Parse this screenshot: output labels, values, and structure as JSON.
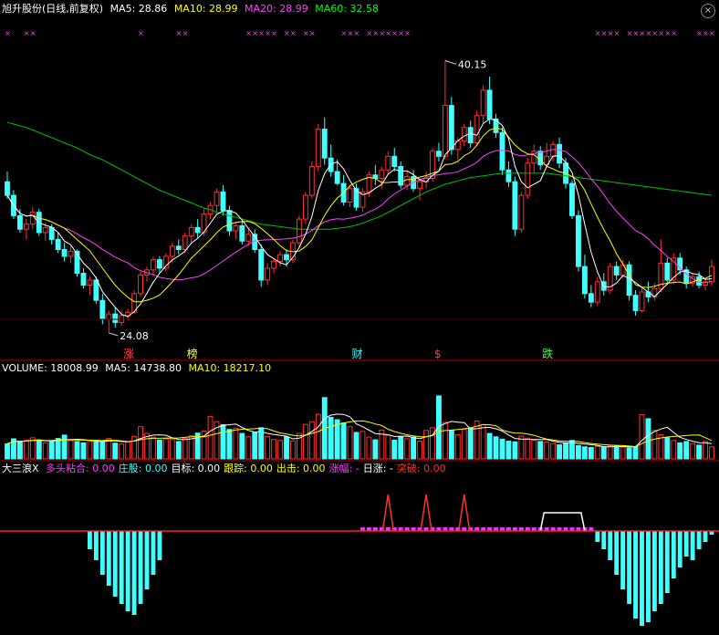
{
  "price_panel": {
    "stock_name": "旭升股份(日线,前复权)",
    "ma5": "MA5: 28.86",
    "ma10": "MA10: 28.99",
    "ma20": "MA20: 28.99",
    "ma60": "MA60: 32.58",
    "high_label": "40.15",
    "low_label": "24.08",
    "event_labels": [
      "涨",
      "榜",
      "财",
      "$",
      "跌"
    ]
  },
  "volume_panel": {
    "volume": "VOLUME: 18008.99",
    "ma5": "MA5: 14738.80",
    "ma10": "MA10: 18217.10"
  },
  "indicator_panel": {
    "name": "大三浪X",
    "items": [
      {
        "label": "多头粘合: 0.00",
        "color": "#ff40ff"
      },
      {
        "label": "庄股: 0.00",
        "color": "#40ffff"
      },
      {
        "label": "目标: 0.00",
        "color": "#ffffff"
      },
      {
        "label": "跟踪: 0.00",
        "color": "#ffff00"
      },
      {
        "label": "出击: 0.00",
        "color": "#ffff00"
      },
      {
        "label": "涨幅: -",
        "color": "#ff40ff"
      },
      {
        "label": "日涨: -",
        "color": "#ffffff"
      },
      {
        "label": "突破: 0.00",
        "color": "#ff3030"
      }
    ]
  },
  "colors": {
    "up": "#ff3030",
    "down": "#40ffff",
    "ma5": "#ffffff",
    "ma10": "#ffff00",
    "ma20": "#ff40ff",
    "ma60": "#00c000",
    "border": "#b00000"
  },
  "chart_data": [
    {
      "type": "candlestick",
      "title": "旭升股份(日线,前复权)",
      "ylim": [
        23,
        42
      ],
      "annotations": [
        {
          "text": "40.15",
          "kind": "high"
        },
        {
          "text": "24.08",
          "kind": "low"
        }
      ],
      "ohlc": [
        [
          33.0,
          33.6,
          32.0,
          32.2
        ],
        [
          32.2,
          32.5,
          30.8,
          31.0
        ],
        [
          31.0,
          31.4,
          30.0,
          30.2
        ],
        [
          30.2,
          30.8,
          29.6,
          30.5
        ],
        [
          30.5,
          31.5,
          30.2,
          31.2
        ],
        [
          31.2,
          31.4,
          29.8,
          30.0
        ],
        [
          30.0,
          30.6,
          29.5,
          30.3
        ],
        [
          30.3,
          30.5,
          29.3,
          29.6
        ],
        [
          29.6,
          30.0,
          28.8,
          29.0
        ],
        [
          29.0,
          29.4,
          28.3,
          28.6
        ],
        [
          28.6,
          29.2,
          28.2,
          28.9
        ],
        [
          28.9,
          29.0,
          27.4,
          27.6
        ],
        [
          27.6,
          27.9,
          26.7,
          26.9
        ],
        [
          26.9,
          27.4,
          26.3,
          27.2
        ],
        [
          27.2,
          27.4,
          25.8,
          26.0
        ],
        [
          26.0,
          26.4,
          24.6,
          24.9
        ],
        [
          24.9,
          25.4,
          24.08,
          25.2
        ],
        [
          25.2,
          25.6,
          24.4,
          24.7
        ],
        [
          24.7,
          25.4,
          24.5,
          25.1
        ],
        [
          25.1,
          25.5,
          24.8,
          25.3
        ],
        [
          25.3,
          26.6,
          25.2,
          26.4
        ],
        [
          26.4,
          27.7,
          26.2,
          27.5
        ],
        [
          27.5,
          28.0,
          27.1,
          27.8
        ],
        [
          27.8,
          28.6,
          27.4,
          28.4
        ],
        [
          28.4,
          28.6,
          27.6,
          27.9
        ],
        [
          27.9,
          28.8,
          27.7,
          28.6
        ],
        [
          28.6,
          29.4,
          28.2,
          29.2
        ],
        [
          29.2,
          29.6,
          28.7,
          29.0
        ],
        [
          29.0,
          30.0,
          28.8,
          29.8
        ],
        [
          29.8,
          30.5,
          29.4,
          30.3
        ],
        [
          30.3,
          30.8,
          29.7,
          30.0
        ],
        [
          30.0,
          31.4,
          29.8,
          31.1
        ],
        [
          31.1,
          31.8,
          30.8,
          31.6
        ],
        [
          31.6,
          32.6,
          31.2,
          32.4
        ],
        [
          32.4,
          32.8,
          31.0,
          31.3
        ],
        [
          31.3,
          31.6,
          29.8,
          30.1
        ],
        [
          30.1,
          30.6,
          29.6,
          30.4
        ],
        [
          30.4,
          30.7,
          29.3,
          29.5
        ],
        [
          29.5,
          30.2,
          29.2,
          29.9
        ],
        [
          29.9,
          30.2,
          28.8,
          29.0
        ],
        [
          29.0,
          29.3,
          26.8,
          27.2
        ],
        [
          27.2,
          28.2,
          26.9,
          27.9
        ],
        [
          27.9,
          28.4,
          27.6,
          28.3
        ],
        [
          28.3,
          28.9,
          28.0,
          28.7
        ],
        [
          28.7,
          29.0,
          28.0,
          28.4
        ],
        [
          28.4,
          29.6,
          28.2,
          29.4
        ],
        [
          29.4,
          31.0,
          29.2,
          30.8
        ],
        [
          30.8,
          32.4,
          30.5,
          32.2
        ],
        [
          32.2,
          34.2,
          32.0,
          33.9
        ],
        [
          33.9,
          36.4,
          33.6,
          36.1
        ],
        [
          36.1,
          36.8,
          34.0,
          34.4
        ],
        [
          34.4,
          35.2,
          33.3,
          33.6
        ],
        [
          33.6,
          34.3,
          32.8,
          32.9
        ],
        [
          32.9,
          33.4,
          31.6,
          31.8
        ],
        [
          31.8,
          32.8,
          31.5,
          32.6
        ],
        [
          32.6,
          32.9,
          31.3,
          31.5
        ],
        [
          31.5,
          32.6,
          31.2,
          32.4
        ],
        [
          32.4,
          33.6,
          32.1,
          33.4
        ],
        [
          33.4,
          34.0,
          32.8,
          33.2
        ],
        [
          33.2,
          33.9,
          32.6,
          33.7
        ],
        [
          33.7,
          34.8,
          33.4,
          34.5
        ],
        [
          34.5,
          35.0,
          33.6,
          33.9
        ],
        [
          33.9,
          34.2,
          32.6,
          32.8
        ],
        [
          32.8,
          33.6,
          32.5,
          33.3
        ],
        [
          33.3,
          33.7,
          32.4,
          32.6
        ],
        [
          32.6,
          33.2,
          31.9,
          33.0
        ],
        [
          33.0,
          33.6,
          32.6,
          33.2
        ],
        [
          33.2,
          35.0,
          33.0,
          34.8
        ],
        [
          34.8,
          35.3,
          34.2,
          34.5
        ],
        [
          34.5,
          40.15,
          34.3,
          37.5
        ],
        [
          37.5,
          38.0,
          34.6,
          34.9
        ],
        [
          34.9,
          35.6,
          34.3,
          35.4
        ],
        [
          35.4,
          36.4,
          35.1,
          36.2
        ],
        [
          36.2,
          36.6,
          35.0,
          35.3
        ],
        [
          35.3,
          37.2,
          35.1,
          36.9
        ],
        [
          36.9,
          38.7,
          36.5,
          38.4
        ],
        [
          38.4,
          39.2,
          36.4,
          36.7
        ],
        [
          36.7,
          37.0,
          35.6,
          35.9
        ],
        [
          35.9,
          36.2,
          33.4,
          33.7
        ],
        [
          33.7,
          34.2,
          32.7,
          33.0
        ],
        [
          33.0,
          33.3,
          29.8,
          30.2
        ],
        [
          30.2,
          32.4,
          30.0,
          32.2
        ],
        [
          32.2,
          34.4,
          32.0,
          34.1
        ],
        [
          34.1,
          35.2,
          33.5,
          34.8
        ],
        [
          34.8,
          35.1,
          33.7,
          34.0
        ],
        [
          34.0,
          35.3,
          33.8,
          34.5
        ],
        [
          34.5,
          35.4,
          34.2,
          35.2
        ],
        [
          35.2,
          35.6,
          33.8,
          34.1
        ],
        [
          34.1,
          34.4,
          32.6,
          32.9
        ],
        [
          32.9,
          33.1,
          30.8,
          31.0
        ],
        [
          31.0,
          31.3,
          27.7,
          28.0
        ],
        [
          28.0,
          28.7,
          26.1,
          26.4
        ],
        [
          26.4,
          26.9,
          25.6,
          25.9
        ],
        [
          25.9,
          27.4,
          25.7,
          27.1
        ],
        [
          27.1,
          27.6,
          26.3,
          26.6
        ],
        [
          26.6,
          28.2,
          26.4,
          28.0
        ],
        [
          28.0,
          28.3,
          27.2,
          27.5
        ],
        [
          27.5,
          28.4,
          27.3,
          28.1
        ],
        [
          28.1,
          28.3,
          26.0,
          26.3
        ],
        [
          26.3,
          26.6,
          25.1,
          25.4
        ],
        [
          25.4,
          26.7,
          25.3,
          26.5
        ],
        [
          26.5,
          27.1,
          25.9,
          26.2
        ],
        [
          26.2,
          27.0,
          26.0,
          26.7
        ],
        [
          26.7,
          29.6,
          26.5,
          28.2
        ],
        [
          28.2,
          28.5,
          27.0,
          27.2
        ],
        [
          27.2,
          28.8,
          27.0,
          28.5
        ],
        [
          28.5,
          28.8,
          27.5,
          27.8
        ],
        [
          27.8,
          28.0,
          26.7,
          27.0
        ],
        [
          27.0,
          27.6,
          26.8,
          27.4
        ],
        [
          27.4,
          27.7,
          26.7,
          26.9
        ],
        [
          26.9,
          27.3,
          26.6,
          27.1
        ],
        [
          27.1,
          28.4,
          26.9,
          28.0
        ]
      ],
      "ma60": [
        36.5,
        36.4,
        36.3,
        36.2,
        36.05,
        35.9,
        35.75,
        35.6,
        35.45,
        35.3,
        35.15,
        35.0,
        34.8,
        34.6,
        34.45,
        34.3,
        34.1,
        33.9,
        33.7,
        33.5,
        33.3,
        33.1,
        32.9,
        32.7,
        32.5,
        32.35,
        32.2,
        32.05,
        31.9,
        31.75,
        31.6,
        31.45,
        31.35,
        31.2,
        31.1,
        31.0,
        30.9,
        30.8,
        30.7,
        30.6,
        30.5,
        30.45,
        30.4,
        30.35,
        30.3,
        30.25,
        30.2,
        30.2,
        30.2,
        30.2,
        30.2,
        30.2,
        30.25,
        30.3,
        30.35,
        30.45,
        30.55,
        30.7,
        30.85,
        31.0,
        31.2,
        31.4,
        31.6,
        31.8,
        32.0,
        32.2,
        32.4,
        32.55,
        32.7,
        32.85,
        32.95,
        33.05,
        33.15,
        33.25,
        33.3,
        33.35,
        33.4,
        33.45,
        33.5,
        33.5,
        33.5,
        33.5,
        33.5,
        33.5,
        33.5,
        33.5,
        33.45,
        33.4,
        33.35,
        33.3,
        33.25,
        33.2,
        33.15,
        33.1,
        33.05,
        33.0,
        32.95,
        32.9,
        32.85,
        32.8,
        32.75,
        32.7,
        32.65,
        32.6,
        32.55,
        32.5,
        32.45,
        32.4,
        32.35,
        32.3,
        32.25,
        32.2
      ]
    },
    {
      "type": "bar",
      "title": "VOLUME",
      "ylim": [
        0,
        24500
      ],
      "values": [
        4500,
        6000,
        5200,
        5600,
        6300,
        5500,
        4800,
        5300,
        6100,
        7100,
        5500,
        5200,
        4800,
        5200,
        5600,
        5200,
        6100,
        4700,
        4400,
        5100,
        6700,
        9600,
        7600,
        6500,
        5600,
        6000,
        5800,
        5200,
        6100,
        6900,
        7700,
        8300,
        12700,
        11100,
        10200,
        8800,
        9200,
        7600,
        6600,
        7900,
        9300,
        6700,
        5800,
        5500,
        6600,
        5400,
        7600,
        10300,
        11100,
        13300,
        18300,
        12400,
        11700,
        10700,
        9600,
        7900,
        8200,
        6500,
        5700,
        8600,
        7100,
        5600,
        6700,
        6000,
        6500,
        5300,
        8500,
        9300,
        18800,
        10900,
        8500,
        7200,
        8800,
        9200,
        11300,
        10200,
        7600,
        6600,
        5900,
        5300,
        5100,
        6800,
        6200,
        5600,
        5200,
        5000,
        4600,
        4200,
        4800,
        5500,
        4000,
        3600,
        3400,
        3700,
        3600,
        3800,
        3900,
        3500,
        3300,
        3700,
        13200,
        12000,
        8500,
        7200,
        6300,
        5500,
        4800,
        5200,
        4600,
        4100,
        5200,
        3600
      ]
    },
    {
      "type": "bar",
      "title": "大三浪X",
      "ylim": [
        -27,
        15
      ],
      "values": [
        0,
        0,
        0,
        0,
        0,
        0,
        0,
        0,
        0,
        0,
        0,
        0,
        0,
        -5,
        -8,
        -12,
        -15,
        -18,
        -20,
        -22,
        -23,
        -20,
        -16,
        -12,
        -8,
        0,
        0,
        0,
        0,
        0,
        0,
        0,
        0,
        0,
        0,
        0,
        0,
        0,
        0,
        0,
        0,
        0,
        0,
        0,
        0,
        0,
        0,
        0,
        0,
        0,
        0,
        0,
        0,
        0,
        0,
        0,
        0,
        0,
        0,
        0,
        0,
        0,
        0,
        0,
        0,
        0,
        0,
        0,
        0,
        0,
        0,
        0,
        0,
        0,
        0,
        0,
        0,
        0,
        0,
        0,
        0,
        0,
        0,
        0,
        0,
        0,
        0,
        0,
        0,
        0,
        0,
        0,
        0,
        -3,
        -5,
        -8,
        -12,
        -16,
        -20,
        -24,
        -26,
        -25,
        -22,
        -20,
        -17,
        -13,
        -10,
        -7,
        -8,
        -5,
        -3,
        -1
      ]
    }
  ]
}
